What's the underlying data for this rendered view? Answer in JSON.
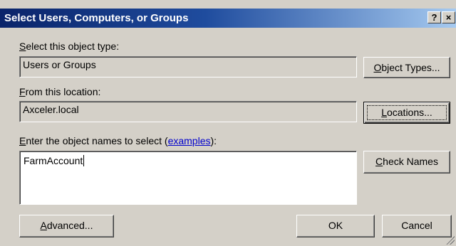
{
  "window": {
    "title": "Select Users, Computers, or Groups",
    "help_glyph": "?",
    "close_glyph": "×"
  },
  "object_type": {
    "label": "Select this object type:",
    "value": "Users or Groups",
    "button": "Object Types..."
  },
  "location": {
    "label": "From this location:",
    "value": "Axceler.local",
    "button": "Locations..."
  },
  "names": {
    "label_prefix": "Enter the object names to select (",
    "link": "examples",
    "label_suffix": "):",
    "value": "FarmAccount",
    "button": "Check Names"
  },
  "footer": {
    "advanced": "Advanced...",
    "ok": "OK",
    "cancel": "Cancel"
  }
}
